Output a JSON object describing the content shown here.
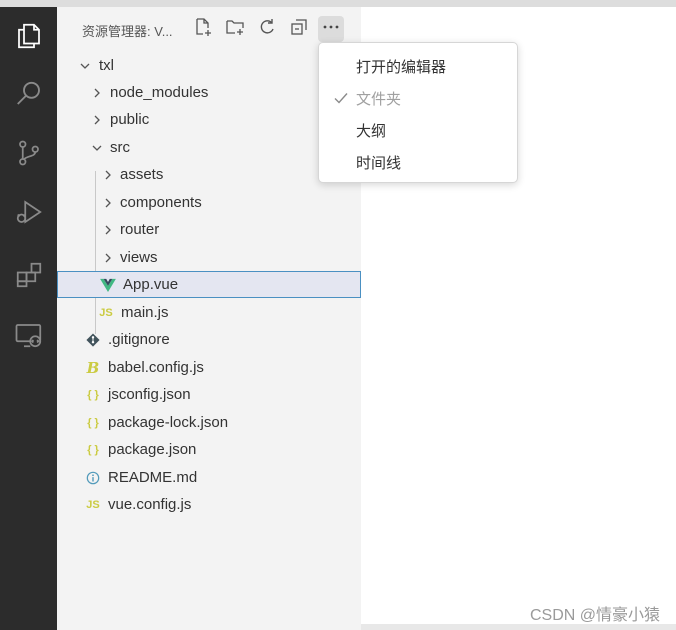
{
  "sidebar": {
    "title": "资源管理器: V...",
    "tree": [
      {
        "label": "txl",
        "type": "folder-open",
        "icon": "chevron-down-icon"
      },
      {
        "label": "node_modules",
        "type": "folder",
        "icon": "chevron-right-icon"
      },
      {
        "label": "public",
        "type": "folder",
        "icon": "chevron-right-icon"
      },
      {
        "label": "src",
        "type": "folder-open",
        "icon": "chevron-down-icon"
      },
      {
        "label": "assets",
        "type": "folder",
        "icon": "chevron-right-icon"
      },
      {
        "label": "components",
        "type": "folder",
        "icon": "chevron-right-icon"
      },
      {
        "label": "router",
        "type": "folder",
        "icon": "chevron-right-icon"
      },
      {
        "label": "views",
        "type": "folder",
        "icon": "chevron-right-icon"
      },
      {
        "label": "App.vue",
        "type": "file",
        "icon": "vue-file-icon",
        "selected": true
      },
      {
        "label": "main.js",
        "type": "file",
        "icon": "js-file-icon",
        "badge": "JS"
      },
      {
        "label": ".gitignore",
        "type": "file",
        "icon": "git-file-icon"
      },
      {
        "label": "babel.config.js",
        "type": "file",
        "icon": "babel-file-icon"
      },
      {
        "label": "jsconfig.json",
        "type": "file",
        "icon": "json-file-icon",
        "badge": "{ }"
      },
      {
        "label": "package-lock.json",
        "type": "file",
        "icon": "json-file-icon",
        "badge": "{ }"
      },
      {
        "label": "package.json",
        "type": "file",
        "icon": "json-file-icon",
        "badge": "{ }"
      },
      {
        "label": "README.md",
        "type": "file",
        "icon": "info-file-icon"
      },
      {
        "label": "vue.config.js",
        "type": "file",
        "icon": "js-file-icon",
        "badge": "JS"
      }
    ]
  },
  "menu": {
    "items": [
      {
        "label": "打开的编辑器",
        "checked": false,
        "disabled": false
      },
      {
        "label": "文件夹",
        "checked": true,
        "disabled": true
      },
      {
        "label": "大纲",
        "checked": false,
        "disabled": false
      },
      {
        "label": "时间线",
        "checked": false,
        "disabled": false
      }
    ]
  },
  "watermark": "CSDN @情豪小猿",
  "colors": {
    "activity_bar": "#2c2c2c",
    "sidebar_bg": "#f3f3f3",
    "selection_bg": "#e4e6f1",
    "selection_border": "#4a90c2",
    "vue_green": "#41b883",
    "js_yellow": "#cbcb41",
    "json_yellow": "#cbcb41",
    "info_blue": "#519aba"
  }
}
